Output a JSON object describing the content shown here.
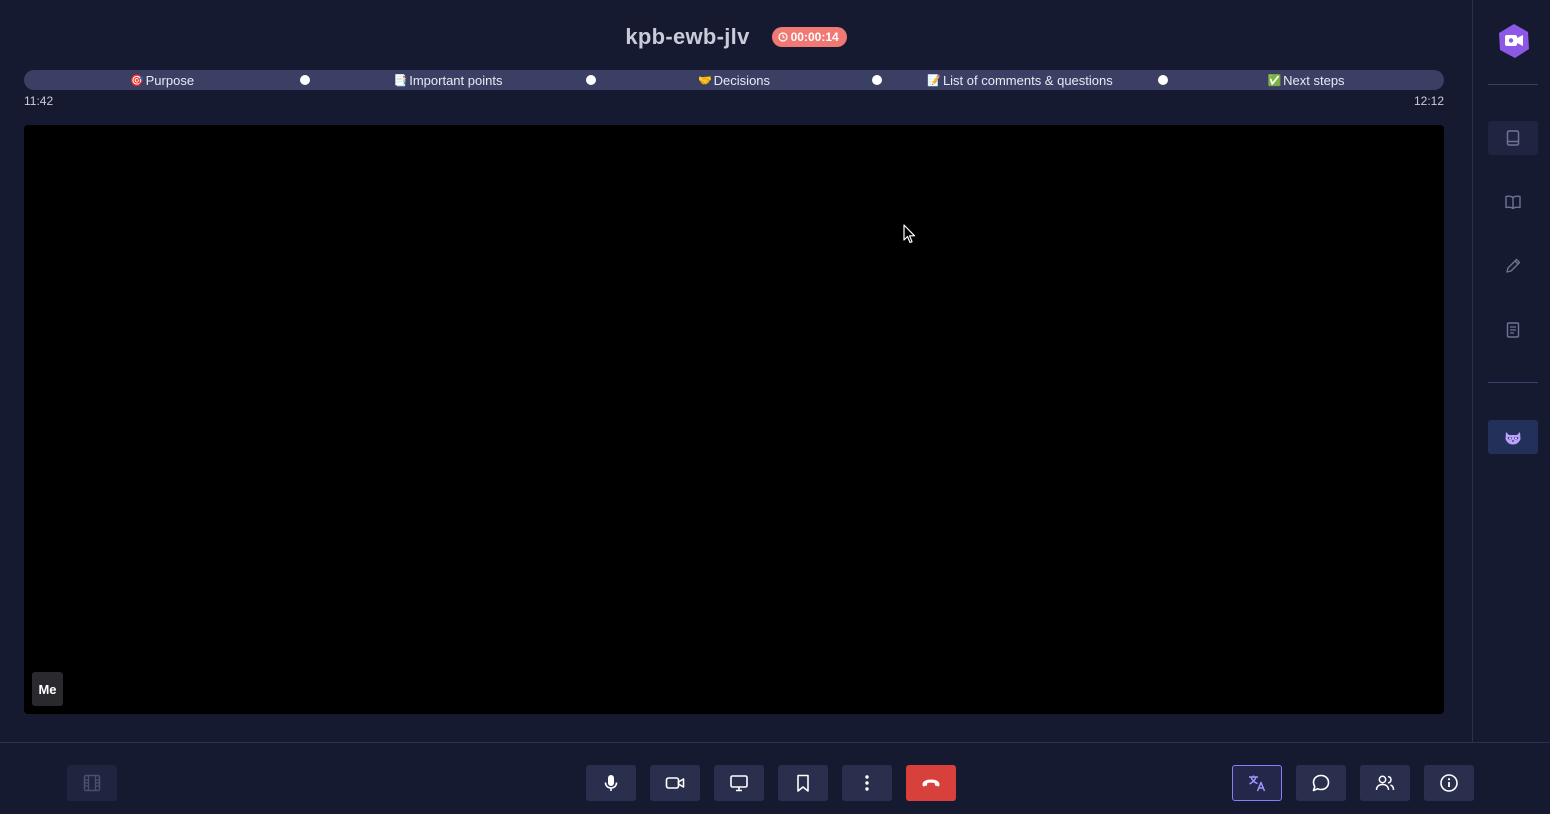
{
  "header": {
    "room_name": "kpb-ewb-jlv",
    "timer": "00:00:14"
  },
  "agenda": {
    "items": [
      {
        "emoji": "🎯",
        "label": "Purpose"
      },
      {
        "emoji": "📑",
        "label": "Important points"
      },
      {
        "emoji": "🤝",
        "label": "Decisions"
      },
      {
        "emoji": "📝",
        "label": "List of comments & questions"
      },
      {
        "emoji": "✅",
        "label": "Next steps"
      }
    ],
    "start_time": "11:42",
    "end_time": "12:12"
  },
  "video": {
    "self_label": "Me"
  },
  "colors": {
    "background": "#161a31",
    "agenda_bar": "#3a3f63",
    "timer_badge": "#f07a73",
    "hangup": "#d8403c",
    "accent": "#8b7bff",
    "logo": "#8e58e6"
  },
  "sidebar": {
    "items": [
      "app-logo-icon",
      "notebook-icon",
      "book-open-icon",
      "pencil-icon",
      "clipboard-icon",
      "raccoon-assistant-icon"
    ]
  },
  "toolbar": {
    "items": [
      "film-icon",
      "microphone-icon",
      "camera-icon",
      "screen-share-icon",
      "bookmark-icon",
      "more-vertical-icon",
      "hangup-icon",
      "translate-icon",
      "chat-icon",
      "participants-icon",
      "info-icon"
    ]
  }
}
